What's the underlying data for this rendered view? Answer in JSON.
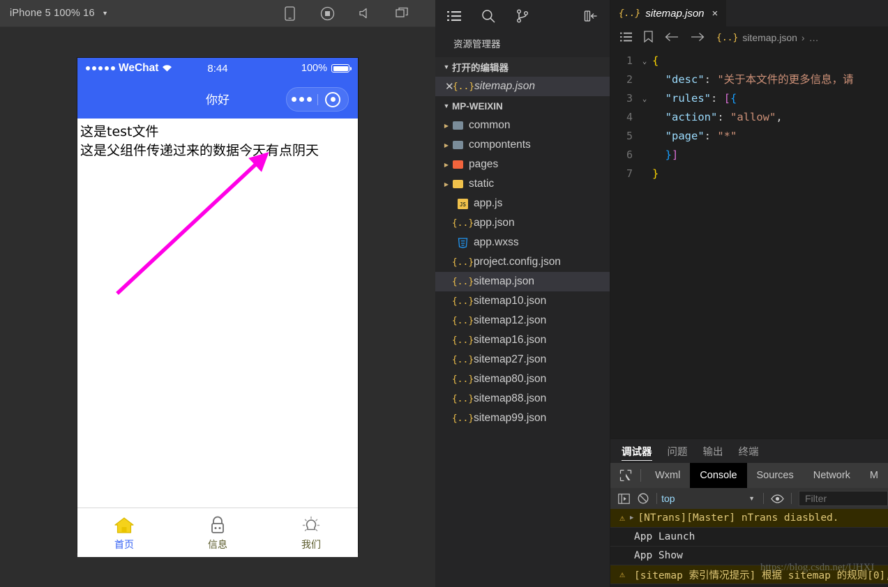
{
  "simulator": {
    "device_label": "iPhone 5 100% 16",
    "toolbar_icons": [
      "device-icon",
      "record-icon",
      "volume-icon",
      "windows-icon"
    ],
    "status_bar": {
      "carrier": "WeChat",
      "time": "8:44",
      "battery": "100%"
    },
    "nav_title": "你好",
    "page_lines": [
      "这是test文件",
      "这是父组件传递过来的数据今天有点阴天"
    ],
    "tabbar": [
      {
        "label": "首页",
        "icon": "home-icon",
        "active": true
      },
      {
        "label": "信息",
        "icon": "lock-icon",
        "active": false
      },
      {
        "label": "我们",
        "icon": "bulb-icon",
        "active": false
      }
    ]
  },
  "explorer": {
    "actions": [
      "explorer-icon",
      "search-icon",
      "source-control-icon",
      "collapse-sidebar-icon"
    ],
    "title": "资源管理器",
    "open_editors": {
      "label": "打开的编辑器",
      "items": [
        {
          "name": "sitemap.json",
          "icon": "json-icon"
        }
      ]
    },
    "project": {
      "label": "MP-WEIXIN",
      "folders": [
        {
          "name": "common",
          "color": "#7a8c99"
        },
        {
          "name": "compontents",
          "color": "#7a8c99"
        },
        {
          "name": "pages",
          "color": "#f2643d"
        },
        {
          "name": "static",
          "color": "#f0c14b"
        }
      ],
      "files": [
        {
          "name": "app.js",
          "icon": "js-icon",
          "selected": false
        },
        {
          "name": "app.json",
          "icon": "json-icon",
          "selected": false
        },
        {
          "name": "app.wxss",
          "icon": "css-icon",
          "selected": false
        },
        {
          "name": "project.config.json",
          "icon": "json-icon",
          "selected": false
        },
        {
          "name": "sitemap.json",
          "icon": "json-icon",
          "selected": true
        },
        {
          "name": "sitemap10.json",
          "icon": "json-icon",
          "selected": false
        },
        {
          "name": "sitemap12.json",
          "icon": "json-icon",
          "selected": false
        },
        {
          "name": "sitemap16.json",
          "icon": "json-icon",
          "selected": false
        },
        {
          "name": "sitemap27.json",
          "icon": "json-icon",
          "selected": false
        },
        {
          "name": "sitemap80.json",
          "icon": "json-icon",
          "selected": false
        },
        {
          "name": "sitemap88.json",
          "icon": "json-icon",
          "selected": false
        },
        {
          "name": "sitemap99.json",
          "icon": "json-icon",
          "selected": false
        }
      ]
    }
  },
  "editor": {
    "tab": {
      "title": "sitemap.json",
      "close": "×",
      "icon": "json-icon"
    },
    "breadcrumb": {
      "outline_icon": "outline-icon",
      "bookmark_icon": "bookmark-icon",
      "back_icon": "arrow-left-icon",
      "forward_icon": "arrow-right-icon",
      "file": "sitemap.json",
      "separator": "›",
      "more": "…"
    },
    "lines": [
      {
        "n": "1",
        "fold": "⌄",
        "segments": [
          {
            "t": "{",
            "c": "b1"
          }
        ]
      },
      {
        "n": "2",
        "fold": "",
        "segments": [
          {
            "t": "  ",
            "c": "w"
          },
          {
            "t": "\"desc\"",
            "c": "k"
          },
          {
            "t": ": ",
            "c": "w"
          },
          {
            "t": "\"关于本文件的更多信息，请",
            "c": "s"
          }
        ]
      },
      {
        "n": "3",
        "fold": "⌄",
        "segments": [
          {
            "t": "  ",
            "c": "w"
          },
          {
            "t": "\"rules\"",
            "c": "k"
          },
          {
            "t": ": ",
            "c": "w"
          },
          {
            "t": "[",
            "c": "b2"
          },
          {
            "t": "{",
            "c": "b3"
          }
        ]
      },
      {
        "n": "4",
        "fold": "",
        "segments": [
          {
            "t": "  ",
            "c": "w"
          },
          {
            "t": "\"action\"",
            "c": "k"
          },
          {
            "t": ": ",
            "c": "w"
          },
          {
            "t": "\"allow\"",
            "c": "s"
          },
          {
            "t": ",",
            "c": "w"
          }
        ]
      },
      {
        "n": "5",
        "fold": "",
        "segments": [
          {
            "t": "  ",
            "c": "w"
          },
          {
            "t": "\"page\"",
            "c": "k"
          },
          {
            "t": ": ",
            "c": "w"
          },
          {
            "t": "\"*\"",
            "c": "s"
          }
        ]
      },
      {
        "n": "6",
        "fold": "",
        "segments": [
          {
            "t": "  ",
            "c": "w"
          },
          {
            "t": "}",
            "c": "b3"
          },
          {
            "t": "]",
            "c": "b2"
          }
        ]
      },
      {
        "n": "7",
        "fold": "",
        "segments": [
          {
            "t": "}",
            "c": "b1"
          }
        ]
      }
    ]
  },
  "debugger": {
    "panel_tabs": [
      {
        "label": "调试器",
        "active": true
      },
      {
        "label": "问题",
        "active": false
      },
      {
        "label": "输出",
        "active": false
      },
      {
        "label": "终端",
        "active": false
      }
    ],
    "devtools_tabs": [
      {
        "label": "Wxml",
        "active": false
      },
      {
        "label": "Console",
        "active": true
      },
      {
        "label": "Sources",
        "active": false
      },
      {
        "label": "Network",
        "active": false
      },
      {
        "label": "M",
        "active": false
      }
    ],
    "inspect_icon": "inspect-icon",
    "console_toolbar": {
      "sidebar_icon": "console-sidebar-icon",
      "clear_icon": "clear-console-icon",
      "context": "top",
      "eye_icon": "eye-icon",
      "filter_placeholder": "Filter"
    },
    "messages": [
      {
        "level": "warn",
        "expandable": true,
        "text": "[NTrans][Master] nTrans diasbled."
      },
      {
        "level": "info",
        "expandable": false,
        "text": "App Launch"
      },
      {
        "level": "info",
        "expandable": false,
        "text": "App Show"
      },
      {
        "level": "warn",
        "expandable": false,
        "text": "[sitemap 索引情况提示] 根据 sitemap 的规则[0],"
      }
    ]
  },
  "watermark": "https://blog.csdn.net/UHXI",
  "annotation": {
    "name": "magenta-arrow",
    "color": "#ff00e6"
  }
}
